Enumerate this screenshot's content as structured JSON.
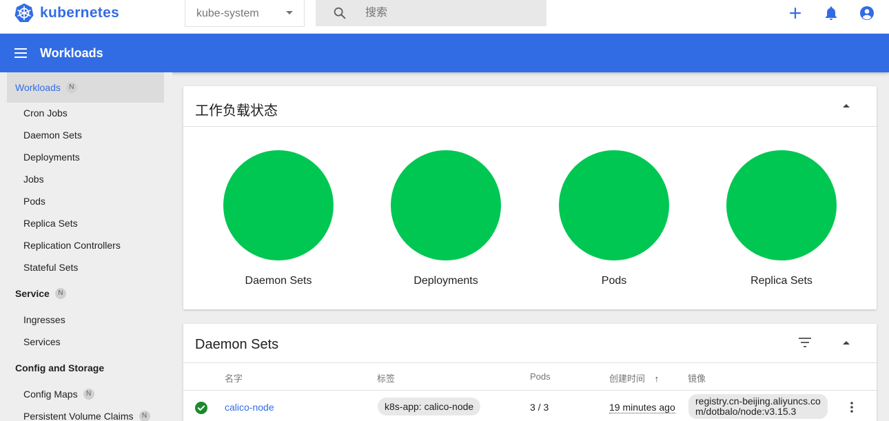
{
  "brand": {
    "name": "kubernetes",
    "logo_icon": "kubernetes-logo-icon",
    "color": "#326ce5"
  },
  "namespace": {
    "selected": "kube-system"
  },
  "search": {
    "placeholder": "搜索"
  },
  "top_actions": [
    {
      "icon": "add-icon"
    },
    {
      "icon": "notifications-icon"
    },
    {
      "icon": "account-icon"
    }
  ],
  "header": {
    "title": "Workloads",
    "color": "#326ce5"
  },
  "sidebar": {
    "sections": [
      {
        "label": "Workloads",
        "badge": "N",
        "active": true,
        "items": [
          "Cron Jobs",
          "Daemon Sets",
          "Deployments",
          "Jobs",
          "Pods",
          "Replica Sets",
          "Replication Controllers",
          "Stateful Sets"
        ]
      },
      {
        "label": "Service",
        "badge": "N",
        "items": [
          "Ingresses",
          "Services"
        ]
      },
      {
        "label": "Config and Storage",
        "items": [
          "Config Maps",
          "Persistent Volume Claims"
        ],
        "item_badges": [
          "N",
          "N"
        ]
      }
    ]
  },
  "status_card": {
    "title": "工作负载状态",
    "status_color": "#00c752",
    "items": [
      {
        "label": "Daemon Sets"
      },
      {
        "label": "Deployments"
      },
      {
        "label": "Pods"
      },
      {
        "label": "Replica Sets"
      }
    ]
  },
  "daemon_sets": {
    "title": "Daemon Sets",
    "columns": [
      "名字",
      "标签",
      "Pods",
      "创建时间",
      "镜像"
    ],
    "sort_indicator": "↑",
    "rows": [
      {
        "status": "running",
        "name": "calico-node",
        "label": "k8s-app: calico-node",
        "pods": "3 / 3",
        "created": "19 minutes ago",
        "image_line1": "registry.cn-beijing.aliyuncs.co",
        "image_line2": "m/dotbalo/node:v3.15.3"
      }
    ]
  }
}
